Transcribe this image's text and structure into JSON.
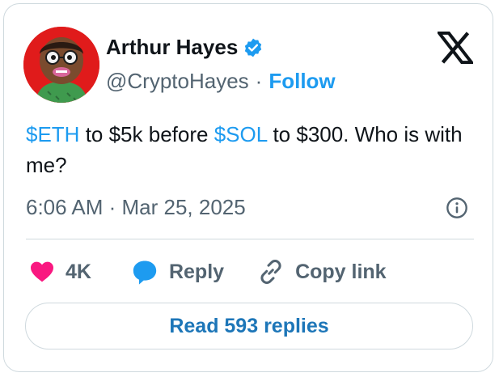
{
  "author": {
    "name": "Arthur Hayes",
    "handle": "@CryptoHayes",
    "verified": true,
    "follow_label": "Follow"
  },
  "tweet": {
    "parts": [
      {
        "text": "$ETH",
        "type": "cashtag"
      },
      {
        "text": " to $5k before ",
        "type": "text"
      },
      {
        "text": "$SOL",
        "type": "cashtag"
      },
      {
        "text": " to $300. Who is with me?",
        "type": "text"
      }
    ],
    "timestamp": "6:06 AM · Mar 25, 2025"
  },
  "actions": {
    "likes": "4K",
    "reply_label": "Reply",
    "copy_link_label": "Copy link"
  },
  "read_replies_label": "Read 593 replies",
  "colors": {
    "accent": "#1d9bf0",
    "like": "#f91880",
    "secondary_text": "#536471",
    "border": "#cfd9de"
  },
  "icons": [
    "x-logo-icon",
    "verified-badge-icon",
    "info-icon",
    "heart-icon",
    "reply-bubble-icon",
    "link-icon"
  ]
}
